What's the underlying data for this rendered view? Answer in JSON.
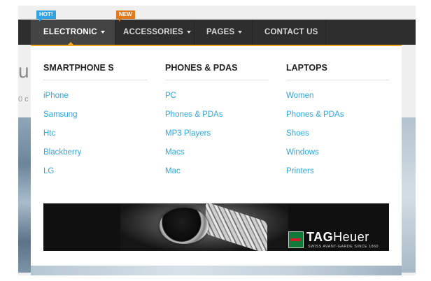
{
  "nav": {
    "items": [
      {
        "label": "ELECTRONIC",
        "active": true,
        "caret": true
      },
      {
        "label": "ACCESSORIES",
        "active": false,
        "caret": true
      },
      {
        "label": "PAGES",
        "active": false,
        "caret": true
      },
      {
        "label": "CONTACT US",
        "active": false,
        "caret": false
      }
    ],
    "badges": {
      "hot": "HOT!",
      "new": "NEW"
    },
    "accent_color": "#f5a623"
  },
  "background": {
    "partial_heading": "u",
    "partial_text": "0 c"
  },
  "dropdown": {
    "columns": [
      {
        "heading": "SMARTPHONE S",
        "links": [
          "iPhone",
          "Samsung",
          "Htc",
          "Blackberry",
          "LG"
        ]
      },
      {
        "heading": "PHONES & PDAS",
        "links": [
          "PC",
          "Phones & PDAs",
          "MP3 Players",
          "Macs",
          "Mac"
        ]
      },
      {
        "heading": "LAPTOPS",
        "links": [
          "Women",
          "Phones & PDAs",
          "Shoes",
          "Windows",
          "Printers"
        ]
      }
    ],
    "link_color": "#2fa7df",
    "banner": {
      "brand_bold": "TAG",
      "brand_light": "Heuer",
      "tagline": "SWISS AVANT-GARDE SINCE 1860",
      "icon": "watch-image"
    }
  }
}
